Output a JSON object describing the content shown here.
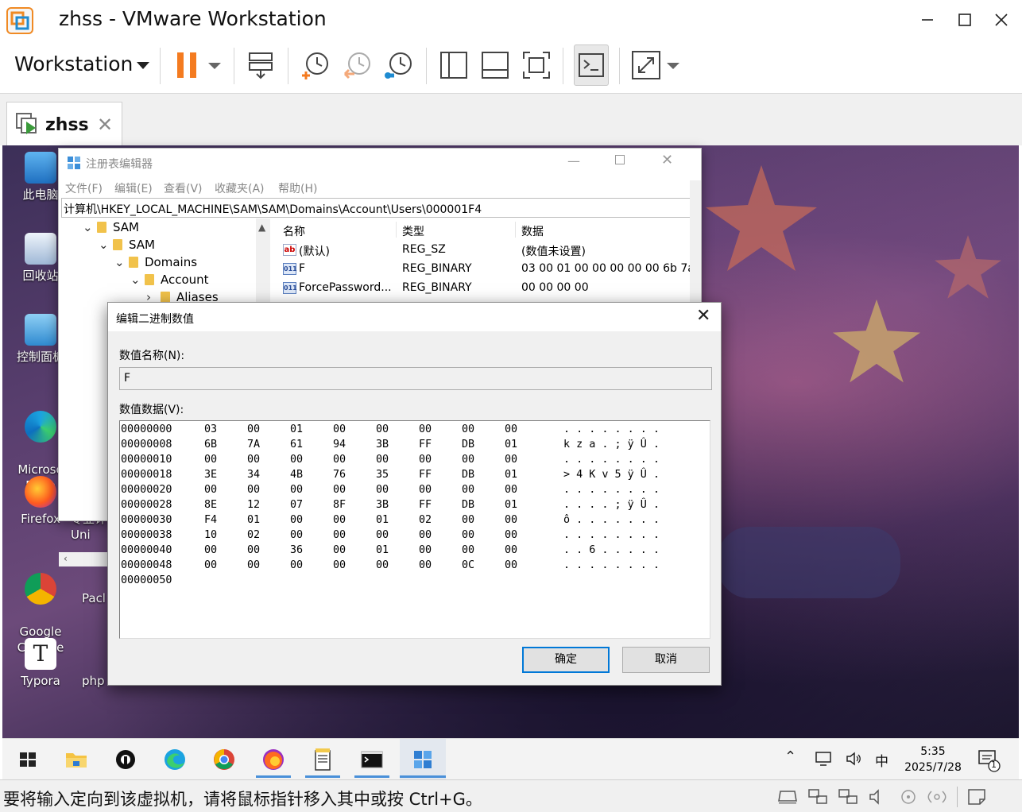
{
  "window": {
    "title": "zhss - VMware Workstation",
    "minimize_label": "minimize",
    "maximize_label": "maximize",
    "close_label": "close"
  },
  "toolbar": {
    "workstation_menu": "Workstation",
    "items": [
      "pause-icon",
      "send-keys-icon",
      "snapshot-take-icon",
      "snapshot-revert-icon",
      "snapshot-manager-icon",
      "sidebar-view-icon",
      "thumbnail-view-icon",
      "fullscreen-icon",
      "console-view-icon",
      "stretch-icon"
    ]
  },
  "tab": {
    "label": "zhss"
  },
  "desktop_icons": [
    {
      "label": "此电脑"
    },
    {
      "label": "回收站"
    },
    {
      "label": "控制面板"
    },
    {
      "label": "Microso\nEdge"
    },
    {
      "label": "Firefox"
    },
    {
      "label": "专业计\nUni"
    },
    {
      "label": "Google\nChrome"
    },
    {
      "label": "Pacl"
    },
    {
      "label": "Typora"
    },
    {
      "label": "php"
    }
  ],
  "regedit": {
    "title": "注册表编辑器",
    "menu": [
      "文件(F)",
      "编辑(E)",
      "查看(V)",
      "收藏夹(A)",
      "帮助(H)"
    ],
    "address": "计算机\\HKEY_LOCAL_MACHINE\\SAM\\SAM\\Domains\\Account\\Users\\000001F4",
    "tree": [
      "SAM",
      "SAM",
      "Domains",
      "Account",
      "Aliases"
    ],
    "columns": [
      "名称",
      "类型",
      "数据"
    ],
    "rows": [
      {
        "icon": "ab",
        "name": "(默认)",
        "type": "REG_SZ",
        "data": "(数值未设置)"
      },
      {
        "icon": "bin",
        "name": "F",
        "type": "REG_BINARY",
        "data": "03 00 01 00 00 00 00 00 6b 7a"
      },
      {
        "icon": "bin",
        "name": "ForcePassword...",
        "type": "REG_BINARY",
        "data": "00 00 00 00"
      }
    ]
  },
  "dialog": {
    "title": "编辑二进制数值",
    "name_label": "数值名称(N):",
    "name_value": "F",
    "data_label": "数值数据(V):",
    "hex_rows": [
      {
        "offset": "00000000",
        "bytes": [
          "03",
          "00",
          "01",
          "00",
          "00",
          "00",
          "00",
          "00"
        ],
        "ascii": ". . . . . . . ."
      },
      {
        "offset": "00000008",
        "bytes": [
          "6B",
          "7A",
          "61",
          "94",
          "3B",
          "FF",
          "DB",
          "01"
        ],
        "ascii": "k z a . ; ÿ Û ."
      },
      {
        "offset": "00000010",
        "bytes": [
          "00",
          "00",
          "00",
          "00",
          "00",
          "00",
          "00",
          "00"
        ],
        "ascii": ". . . . . . . ."
      },
      {
        "offset": "00000018",
        "bytes": [
          "3E",
          "34",
          "4B",
          "76",
          "35",
          "FF",
          "DB",
          "01"
        ],
        "ascii": "> 4 K v 5 ÿ Û ."
      },
      {
        "offset": "00000020",
        "bytes": [
          "00",
          "00",
          "00",
          "00",
          "00",
          "00",
          "00",
          "00"
        ],
        "ascii": ". . . . . . . ."
      },
      {
        "offset": "00000028",
        "bytes": [
          "8E",
          "12",
          "07",
          "8F",
          "3B",
          "FF",
          "DB",
          "01"
        ],
        "ascii": ". . . . ; ÿ Û ."
      },
      {
        "offset": "00000030",
        "bytes": [
          "F4",
          "01",
          "00",
          "00",
          "01",
          "02",
          "00",
          "00"
        ],
        "ascii": "ô . . . . . . ."
      },
      {
        "offset": "00000038",
        "bytes": [
          "10",
          "02",
          "00",
          "00",
          "00",
          "00",
          "00",
          "00"
        ],
        "ascii": ". . . . . . . ."
      },
      {
        "offset": "00000040",
        "bytes": [
          "00",
          "00",
          "36",
          "00",
          "01",
          "00",
          "00",
          "00"
        ],
        "ascii": ". . 6 . . . . ."
      },
      {
        "offset": "00000048",
        "bytes": [
          "00",
          "00",
          "00",
          "00",
          "00",
          "00",
          "0C",
          "00"
        ],
        "ascii": ". . . . . . . ."
      },
      {
        "offset": "00000050",
        "bytes": [],
        "ascii": ""
      }
    ],
    "ok_label": "确定",
    "cancel_label": "取消"
  },
  "taskbar": {
    "apps": [
      "start-icon",
      "file-explorer-icon",
      "app-icon",
      "edge-icon",
      "chrome-icon",
      "firefox-icon",
      "notepad-icon",
      "cmd-icon",
      "regedit-icon"
    ],
    "ime": "中",
    "time": "5:35",
    "date": "2025/7/28",
    "notification_count": "1"
  },
  "statusbar": {
    "message": "要将输入定向到该虚拟机，请将鼠标指针移入其中或按 Ctrl+G。"
  },
  "colors": {
    "accent": "#0078d7",
    "pause_orange": "#f47b20",
    "vm_green": "#3a9a3a"
  }
}
